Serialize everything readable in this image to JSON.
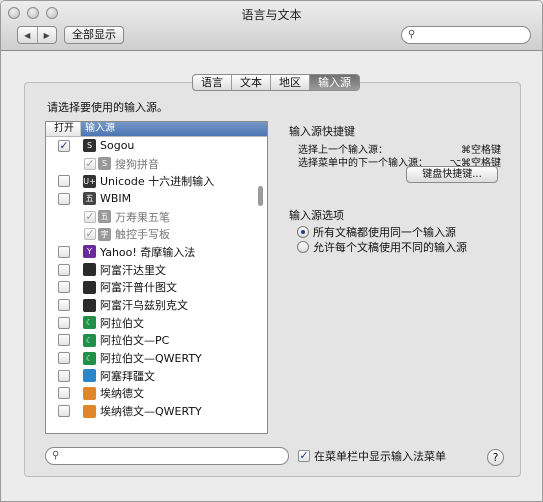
{
  "window": {
    "title": "语言与文本",
    "show_all": "全部显示",
    "search_placeholder": ""
  },
  "tabs": [
    {
      "label": "语言",
      "active": false
    },
    {
      "label": "文本",
      "active": false
    },
    {
      "label": "地区",
      "active": false
    },
    {
      "label": "输入源",
      "active": true
    }
  ],
  "input_sources": {
    "prompt": "请选择要使用的输入源。",
    "col_open": "打开",
    "col_source": "输入源",
    "items": [
      {
        "label": "Sogou",
        "checked": true,
        "sub": false,
        "icon": "S",
        "color": "#2f2f2f"
      },
      {
        "label": "搜狗拼音",
        "checked": true,
        "sub": true,
        "icon": "S",
        "color": "#555555"
      },
      {
        "label": "Unicode 十六进制输入",
        "checked": false,
        "sub": false,
        "icon": "U+",
        "color": "#333333"
      },
      {
        "label": "WBIM",
        "checked": false,
        "sub": false,
        "icon": "五",
        "color": "#444444"
      },
      {
        "label": "万寿果五笔",
        "checked": true,
        "sub": true,
        "icon": "五",
        "color": "#555555"
      },
      {
        "label": "触控手写板",
        "checked": true,
        "sub": true,
        "icon": "字",
        "color": "#555555"
      },
      {
        "label": "Yahoo! 奇摩输入法",
        "checked": false,
        "sub": false,
        "icon": "Y",
        "color": "#6b2a9c"
      },
      {
        "label": "阿富汗达里文",
        "checked": false,
        "sub": false,
        "icon": "",
        "color": "#2b2b2b"
      },
      {
        "label": "阿富汗普什图文",
        "checked": false,
        "sub": false,
        "icon": "",
        "color": "#2b2b2b"
      },
      {
        "label": "阿富汗乌兹别克文",
        "checked": false,
        "sub": false,
        "icon": "",
        "color": "#2b2b2b"
      },
      {
        "label": "阿拉伯文",
        "checked": false,
        "sub": false,
        "icon": "☾",
        "color": "#1f8f4a"
      },
      {
        "label": "阿拉伯文—PC",
        "checked": false,
        "sub": false,
        "icon": "☾",
        "color": "#1f8f4a"
      },
      {
        "label": "阿拉伯文—QWERTY",
        "checked": false,
        "sub": false,
        "icon": "☾",
        "color": "#1f8f4a"
      },
      {
        "label": "阿塞拜疆文",
        "checked": false,
        "sub": false,
        "icon": "",
        "color": "#2a86c8"
      },
      {
        "label": "埃纳德文",
        "checked": false,
        "sub": false,
        "icon": "",
        "color": "#e0862a"
      },
      {
        "label": "埃纳德文—QWERTY",
        "checked": false,
        "sub": false,
        "icon": "",
        "color": "#e0862a"
      }
    ]
  },
  "shortcuts": {
    "heading": "输入源快捷键",
    "prev_label": "选择上一个输入源：",
    "prev_key": "⌘空格键",
    "next_label": "选择菜单中的下一个输入源：",
    "next_key": "⌥⌘空格键",
    "button": "键盘快捷键..."
  },
  "options": {
    "heading": "输入源选项",
    "radio1": "所有文稿都使用同一个输入源",
    "radio2": "允许每个文稿使用不同的输入源",
    "selected": 1
  },
  "bottom": {
    "menu_checkbox": "在菜单栏中显示输入法菜单",
    "menu_checked": true,
    "help": "?"
  }
}
